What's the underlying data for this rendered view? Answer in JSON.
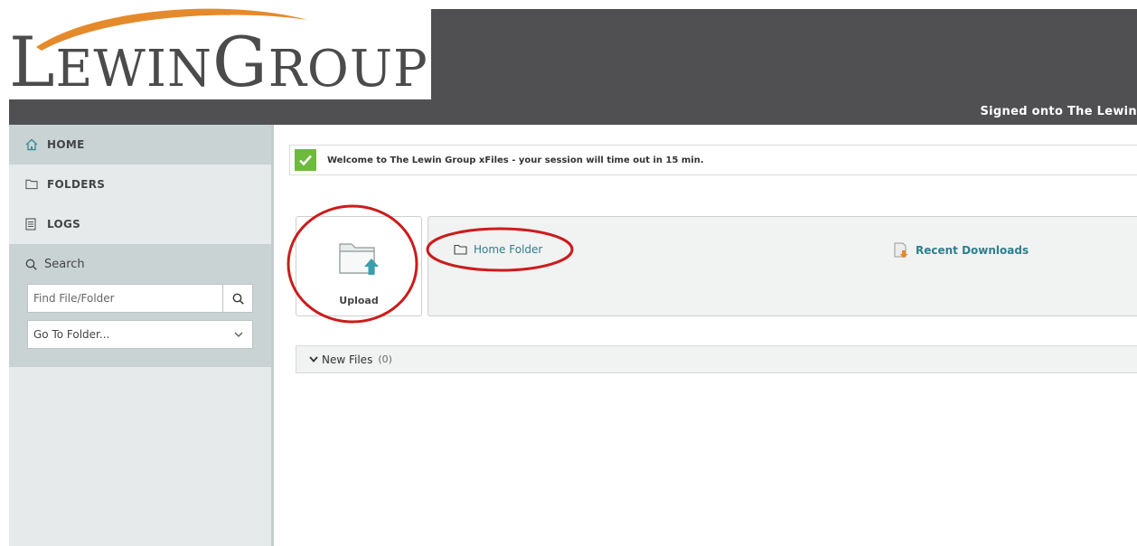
{
  "header": {
    "logo": {
      "big_l": "L",
      "part1": "EWIN",
      "big_g": "G",
      "part2": "ROUP",
      "reg": "®"
    },
    "signed_text": "Signed onto The Lewin",
    "colors": {
      "dark": "#505052",
      "swoosh": "#e58a2b"
    }
  },
  "sidebar": {
    "items": [
      {
        "label": "HOME",
        "icon": "home-icon"
      },
      {
        "label": "FOLDERS",
        "icon": "folder-icon"
      },
      {
        "label": "LOGS",
        "icon": "logs-icon"
      }
    ],
    "search": {
      "heading": "Search",
      "placeholder": "Find File/Folder",
      "goto_label": "Go To Folder..."
    }
  },
  "main": {
    "notice": "Welcome to The Lewin Group xFiles - your session will time out in 15 min.",
    "upload_label": "Upload",
    "home_folder": "Home Folder",
    "recent_downloads": "Recent Downloads",
    "new_files": {
      "label": "New Files",
      "count": "(0)"
    }
  },
  "annotations": {
    "color": "#cc1b1b"
  }
}
